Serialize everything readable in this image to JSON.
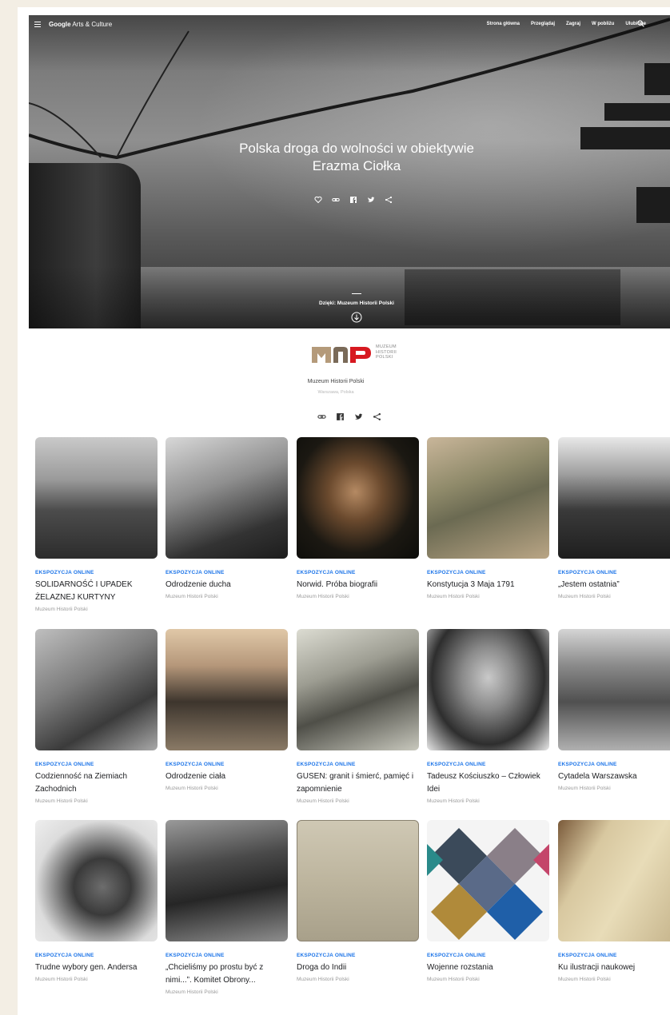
{
  "header": {
    "brand_prefix": "Google",
    "brand_suffix": "Arts & Culture",
    "nav": [
      "Strona główna",
      "Przeglądaj",
      "Zagraj",
      "W pobliżu",
      "Ulubione"
    ]
  },
  "hero": {
    "title": "Polska droga do wolności w obiektywie Erazma Ciołka",
    "credit": "Dzięki: Muzeum Historii Polski",
    "actions": [
      "heart-icon",
      "link-icon",
      "facebook-icon",
      "twitter-icon",
      "share-icon"
    ]
  },
  "partner": {
    "logo_text": [
      "MUZEUM",
      "HISTORII",
      "POLSKI"
    ],
    "name": "Muzeum Historii Polski",
    "location": "Warszawa, Polska",
    "share": [
      "link-icon",
      "facebook-icon",
      "twitter-icon",
      "share-icon"
    ]
  },
  "accent_color": "#1a73e8",
  "cards": [
    {
      "kicker": "EKSPOZYCJA ONLINE",
      "title": "SOLIDARNOŚĆ I UPADEK ŻELAZNEJ KURTYNY",
      "owner": "Muzeum Historii Polski"
    },
    {
      "kicker": "EKSPOZYCJA ONLINE",
      "title": "Odrodzenie ducha",
      "owner": "Muzeum Historii Polski"
    },
    {
      "kicker": "EKSPOZYCJA ONLINE",
      "title": "Norwid. Próba biografii",
      "owner": "Muzeum Historii Polski"
    },
    {
      "kicker": "EKSPOZYCJA ONLINE",
      "title": "Konstytucja 3 Maja 1791",
      "owner": "Muzeum Historii Polski"
    },
    {
      "kicker": "EKSPOZYCJA ONLINE",
      "title": "„Jestem ostatnia”",
      "owner": "Muzeum Historii Polski"
    },
    {
      "kicker": "EKSPOZYCJA ONLINE",
      "title": "Codzienność na Ziemiach Zachodnich",
      "owner": "Muzeum Historii Polski"
    },
    {
      "kicker": "EKSPOZYCJA ONLINE",
      "title": "Odrodzenie ciała",
      "owner": "Muzeum Historii Polski"
    },
    {
      "kicker": "EKSPOZYCJA ONLINE",
      "title": "GUSEN: granit i śmierć, pamięć i zapomnienie",
      "owner": "Muzeum Historii Polski"
    },
    {
      "kicker": "EKSPOZYCJA ONLINE",
      "title": "Tadeusz Kościuszko – Człowiek Idei",
      "owner": "Muzeum Historii Polski"
    },
    {
      "kicker": "EKSPOZYCJA ONLINE",
      "title": "Cytadela Warszawska",
      "owner": "Muzeum Historii Polski"
    },
    {
      "kicker": "EKSPOZYCJA ONLINE",
      "title": "Trudne wybory gen. Andersa",
      "owner": "Muzeum Historii Polski"
    },
    {
      "kicker": "EKSPOZYCJA ONLINE",
      "title": "„Chcieliśmy po prostu być z nimi...”. Komitet Obrony...",
      "owner": "Muzeum Historii Polski"
    },
    {
      "kicker": "EKSPOZYCJA ONLINE",
      "title": "Droga do Indii",
      "owner": "Muzeum Historii Polski"
    },
    {
      "kicker": "EKSPOZYCJA ONLINE",
      "title": "Wojenne rozstania",
      "owner": "Muzeum Historii Polski"
    },
    {
      "kicker": "EKSPOZYCJA ONLINE",
      "title": "Ku ilustracji naukowej",
      "owner": "Muzeum Historii Polski"
    }
  ],
  "thumb_art": [
    "aerial-crowd-photo",
    "bw-crowd-photo",
    "bearded-man-portrait",
    "allegorical-engraving",
    "street-march-photo",
    "ruins-family-photo",
    "sepia-athletes-photo",
    "prisoners-drawing",
    "kosciuszko-portrait",
    "citadel-gate-photo",
    "anders-portrait",
    "truck-crowd-photo",
    "elephant-postcard",
    "diamond-portrait-collage",
    "botanical-book-photo"
  ]
}
